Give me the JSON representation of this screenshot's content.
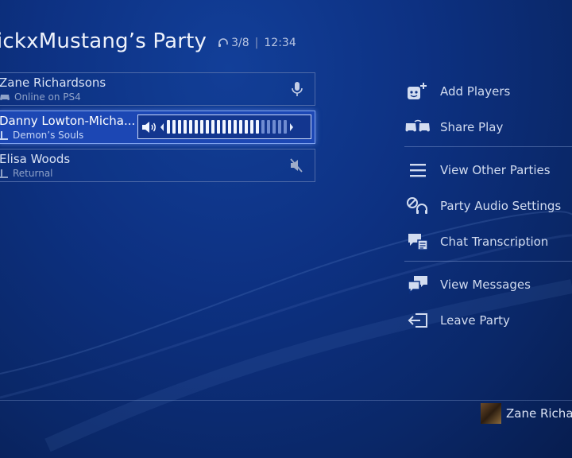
{
  "party": {
    "title": "ickxMustang’s Party",
    "count": "3/8",
    "time": "12:34"
  },
  "players": [
    {
      "name": "Zane Richardsons",
      "status": "Online on PS4",
      "status_icon": "controller-icon",
      "right_icon": "mic-icon"
    },
    {
      "name": "Danny Lowton-Micha...",
      "status": "Demon’s Souls",
      "status_icon": "game-icon",
      "volume_level": 0.75
    },
    {
      "name": "Elisa Woods",
      "status": "Returnal",
      "status_icon": "game-icon",
      "right_icon": "mic-muted-icon"
    }
  ],
  "menu": {
    "items": [
      {
        "label": "Add Players",
        "icon": "add-player-icon"
      },
      {
        "label": "Share Play",
        "icon": "share-play-icon"
      },
      {
        "label": "View Other Parties",
        "icon": "list-icon"
      },
      {
        "label": "Party Audio Settings",
        "icon": "audio-settings-icon"
      },
      {
        "label": "Chat Transcription",
        "icon": "chat-transcription-icon"
      },
      {
        "label": "View Messages",
        "icon": "messages-icon"
      },
      {
        "label": "Leave Party",
        "icon": "leave-icon"
      }
    ]
  },
  "user": {
    "name": "Zane Richar"
  },
  "colors": {
    "background": "#0d3182",
    "selected_row": "#1c47b4",
    "text": "#d2dcf0"
  }
}
